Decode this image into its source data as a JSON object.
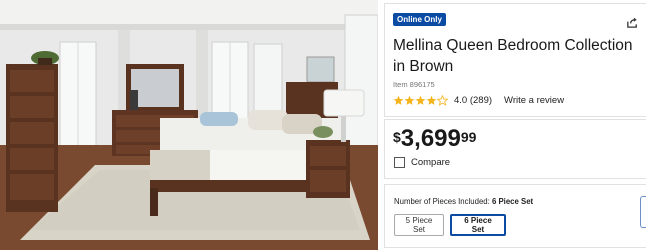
{
  "product": {
    "badge": "Online Only",
    "title": "Mellina Queen Bedroom Collection in Brown",
    "item_number": "Item 896175",
    "rating_value": "4.0",
    "rating_count": "(289)",
    "rating_stars": 4,
    "write_review": "Write a review"
  },
  "price": {
    "currency": "$",
    "dollars": "3,699",
    "cents": "99"
  },
  "compare": {
    "label": "Compare",
    "checked": false
  },
  "pieces": {
    "label": "Number of Pieces Included:",
    "selected": "6 Piece Set",
    "options": [
      "5 Piece Set",
      "6 Piece Set"
    ]
  },
  "icons": {
    "share": "share-icon",
    "star": "star-icon"
  },
  "colors": {
    "badge_bg": "#0c4ba3",
    "selected_border": "#0c4ba3",
    "star_fill": "#f3b41c"
  }
}
